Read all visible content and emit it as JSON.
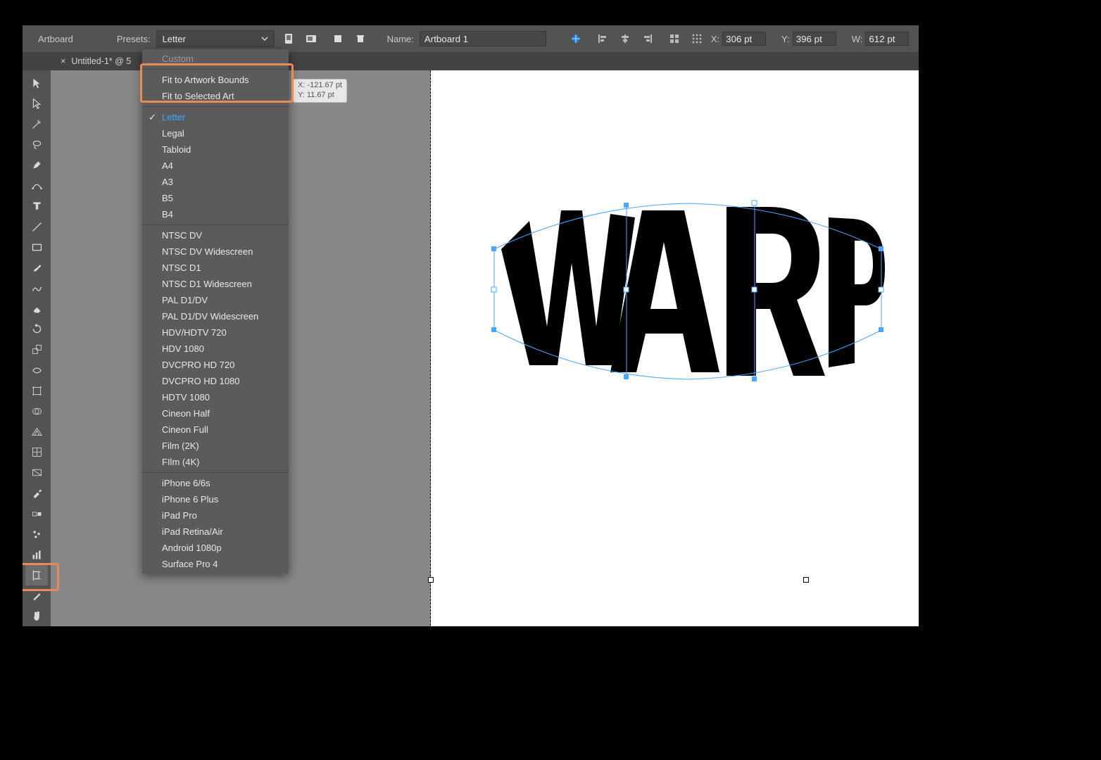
{
  "controlbar": {
    "artboard_label": "Artboard",
    "presets_label": "Presets:",
    "preset_value": "Letter",
    "name_label": "Name:",
    "name_value": "Artboard 1",
    "x_label": "X:",
    "x_value": "306 pt",
    "y_label": "Y:",
    "y_value": "396 pt",
    "w_label": "W:",
    "w_value": "612 pt"
  },
  "tab": {
    "title": "Untitled-1* @   5"
  },
  "coord_tip": {
    "x": "X: -121.67 pt",
    "y": "Y: 11.67 pt"
  },
  "dropdown": {
    "custom": "Custom",
    "fit_bounds": "Fit to Artwork Bounds",
    "fit_selected": "Fit to Selected Art",
    "paper": [
      "Letter",
      "Legal",
      "Tabloid",
      "A4",
      "A3",
      "B5",
      "B4"
    ],
    "video": [
      "NTSC DV",
      "NTSC DV Widescreen",
      "NTSC D1",
      "NTSC D1 Widescreen",
      "PAL D1/DV",
      "PAL D1/DV Widescreen",
      "HDV/HDTV 720",
      "HDV 1080",
      "DVCPRO HD 720",
      "DVCPRO HD 1080",
      "HDTV 1080",
      "Cineon Half",
      "Cineon Full",
      "Film (2K)",
      "FIlm (4K)"
    ],
    "device": [
      "iPhone 6/6s",
      "iPhone 6 Plus",
      "iPad Pro",
      "iPad Retina/Air",
      "Android 1080p",
      "Surface Pro 4"
    ]
  },
  "canvas": {
    "text": "WARP"
  }
}
